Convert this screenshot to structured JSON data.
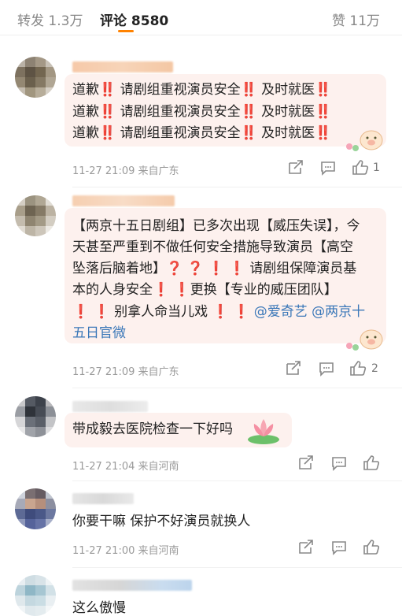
{
  "tabs": {
    "repost": "转发 1.3万",
    "comments": "评论 8580",
    "likes": "赞 11万"
  },
  "comments": [
    {
      "lines": [
        [
          "道歉",
          "‼️",
          " 请剧组重视演员安全",
          "‼️",
          "  及时就医",
          "‼️"
        ],
        [
          "道歉",
          "‼️",
          " 请剧组重视演员安全",
          "‼️",
          "  及时就医",
          "‼️"
        ],
        [
          "道歉",
          "‼️",
          " 请剧组重视演员安全",
          "‼️",
          "  及时就医",
          "‼️"
        ]
      ],
      "meta": "11-27 21:09 来自广东",
      "like_count": "1"
    },
    {
      "lines": [
        "【两京十五日剧组】已多次出现【威压失误】，今",
        "天甚至严重到不做任何安全措施导致演员【高空",
        "坠落后脑着地】",
        "请剧组保障演员基",
        "本的人身安全",
        "更换【专业的威压团队】",
        "别拿人命当儿戏",
        "@爱奇艺",
        "@两京十",
        "五日官微"
      ],
      "marks": {
        "q": "❓",
        "e": "❗"
      },
      "meta": "11-27 21:09 来自广东",
      "like_count": "2"
    },
    {
      "text": "带成毅去医院检查一下好吗",
      "meta": "11-27 21:04 来自河南"
    },
    {
      "text": "你要干嘛 保护不好演员就换人",
      "meta": "11-27 21:00 来自河南"
    },
    {
      "text": "这么傲慢"
    }
  ],
  "icons": {
    "repost": "share-icon",
    "reply": "comment-icon",
    "like": "thumbs-up-icon",
    "sticker_pig": "pig-sticker-icon",
    "sticker_lotus": "lotus-sticker-icon"
  },
  "colors": {
    "accent": "#ff8200",
    "bubble": "#fdf1ee",
    "link": "#3a77b8",
    "exclamation": "#e22222"
  }
}
